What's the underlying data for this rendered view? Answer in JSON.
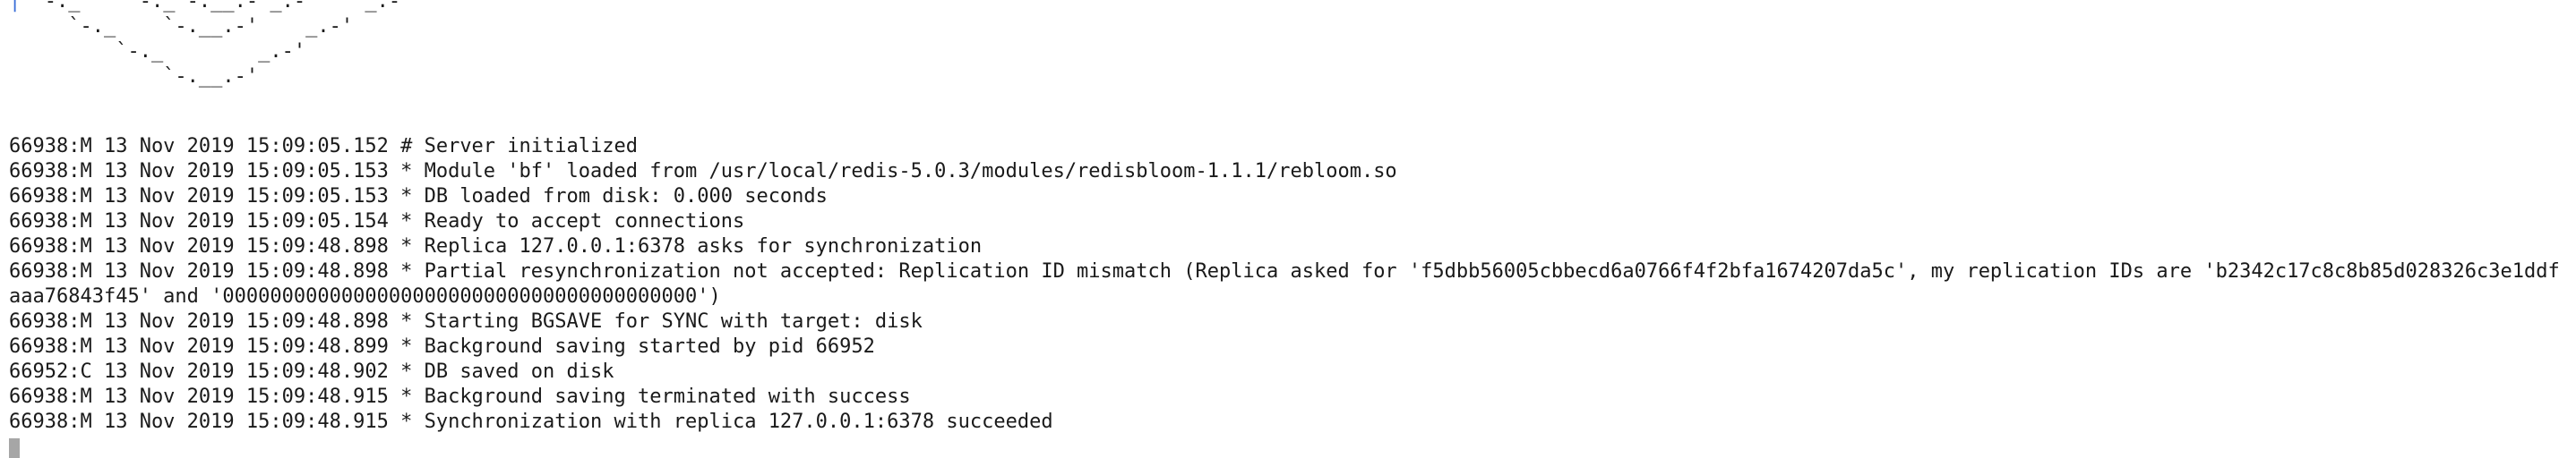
{
  "ascii_art": {
    "lines": [
      " `-._    `-._`-.__.-'_.-'    _.-'",
      "     `-._    `-.__.-'    _.-'",
      "         `-._        _.-'",
      "             `-.__.-'"
    ],
    "edge_mark": "|"
  },
  "log": {
    "lines": [
      "66938:M 13 Nov 2019 15:09:05.152 # Server initialized",
      "66938:M 13 Nov 2019 15:09:05.153 * Module 'bf' loaded from /usr/local/redis-5.0.3/modules/redisbloom-1.1.1/rebloom.so",
      "66938:M 13 Nov 2019 15:09:05.153 * DB loaded from disk: 0.000 seconds",
      "66938:M 13 Nov 2019 15:09:05.154 * Ready to accept connections",
      "66938:M 13 Nov 2019 15:09:48.898 * Replica 127.0.0.1:6378 asks for synchronization",
      "66938:M 13 Nov 2019 15:09:48.898 * Partial resynchronization not accepted: Replication ID mismatch (Replica asked for 'f5dbb56005cbbecd6a0766f4f2bfa1674207da5c', my replication IDs are 'b2342c17c8c8b85d028326c3e1ddfaaa76843f45' and '0000000000000000000000000000000000000000')",
      "66938:M 13 Nov 2019 15:09:48.898 * Starting BGSAVE for SYNC with target: disk",
      "66938:M 13 Nov 2019 15:09:48.899 * Background saving started by pid 66952",
      "66952:C 13 Nov 2019 15:09:48.902 * DB saved on disk",
      "66938:M 13 Nov 2019 15:09:48.915 * Background saving terminated with success",
      "66938:M 13 Nov 2019 15:09:48.915 * Synchronization with replica 127.0.0.1:6378 succeeded"
    ]
  }
}
